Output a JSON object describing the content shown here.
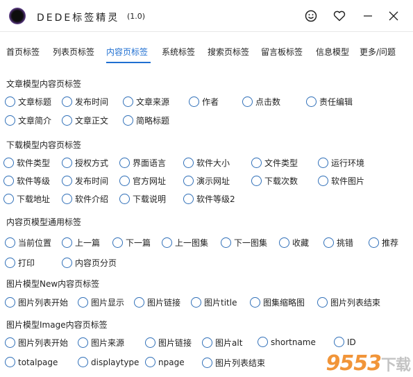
{
  "app": {
    "title": "DEDE标签精灵",
    "version": "(1.0)"
  },
  "titlebar_icons": [
    "smiley-icon",
    "heart-icon",
    "minimize-icon",
    "close-icon"
  ],
  "tabs": [
    {
      "label": "首页标签"
    },
    {
      "label": "列表页标签"
    },
    {
      "label": "内容页标签",
      "active": true
    },
    {
      "label": "系统标签"
    },
    {
      "label": "搜索页标签"
    },
    {
      "label": "留言板标签"
    },
    {
      "label": "信息模型"
    },
    {
      "label": "更多/问题"
    }
  ],
  "sections": [
    {
      "title": "文章模型内容页标签",
      "items": [
        "文章标题",
        "发布时间",
        "文章来源",
        "作者",
        "点击数",
        "责任编辑",
        "文章简介",
        "文章正文",
        "简略标题"
      ]
    },
    {
      "title": "下载模型内容页标签",
      "items": [
        "软件类型",
        "授权方式",
        "界面语言",
        "软件大小",
        "文件类型",
        "运行环境",
        "软件等级",
        "发布时间",
        "官方网址",
        "演示网址",
        "下载次数",
        "软件图片",
        "下载地址",
        "软件介绍",
        "下载说明",
        "软件等级2"
      ]
    },
    {
      "title": "内容页模型通用标签",
      "items": [
        "当前位置",
        "上一篇",
        "下一篇",
        "上一图集",
        "下一图集",
        "收藏",
        "挑错",
        "推荐",
        "打印",
        "内容页分页"
      ]
    },
    {
      "title": "图片模型New内容页标签",
      "items": [
        "图片列表开始",
        "图片显示",
        "图片链接",
        "图片title",
        "图集缩略图",
        "图片列表结束"
      ]
    },
    {
      "title": "图片模型Image内容页标签",
      "items": [
        "图片列表开始",
        "图片来源",
        "图片链接",
        "图片alt",
        "shortname",
        "ID",
        "totalpage",
        "displaytype",
        "npage",
        "图片列表结束"
      ]
    }
  ],
  "watermark": {
    "brand": "9553",
    "suffix": "下载"
  },
  "colors": {
    "accent": "#1f6fd1",
    "radio_border": "#2f6fb8",
    "watermark": "#f08a24"
  }
}
